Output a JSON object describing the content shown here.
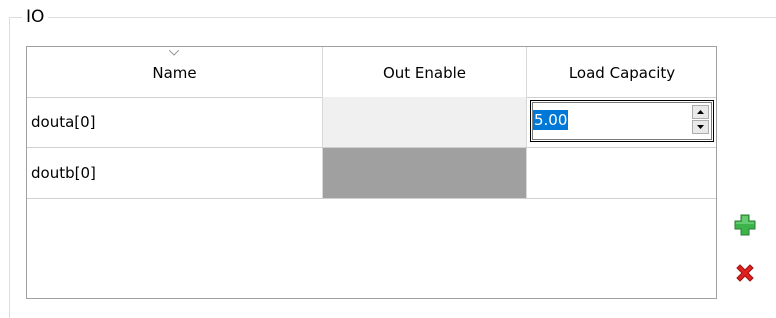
{
  "group": {
    "title": "IO"
  },
  "table": {
    "columns": [
      "Name",
      "Out Enable",
      "Load Capacity"
    ],
    "sort_column": "Name",
    "rows": [
      {
        "name": "douta[0]",
        "out_enable": "",
        "out_enable_disabled": false,
        "load_capacity": "5.00",
        "editing": true
      },
      {
        "name": "doutb[0]",
        "out_enable": "",
        "out_enable_disabled": true,
        "load_capacity": ""
      }
    ]
  },
  "buttons": {
    "add_icon": "green-plus-icon",
    "delete_icon": "red-x-icon"
  },
  "colors": {
    "selection": "#0078d7",
    "disabled_cell": "#a0a0a0",
    "add_green": "#3cb44a",
    "delete_red": "#e0201f"
  }
}
